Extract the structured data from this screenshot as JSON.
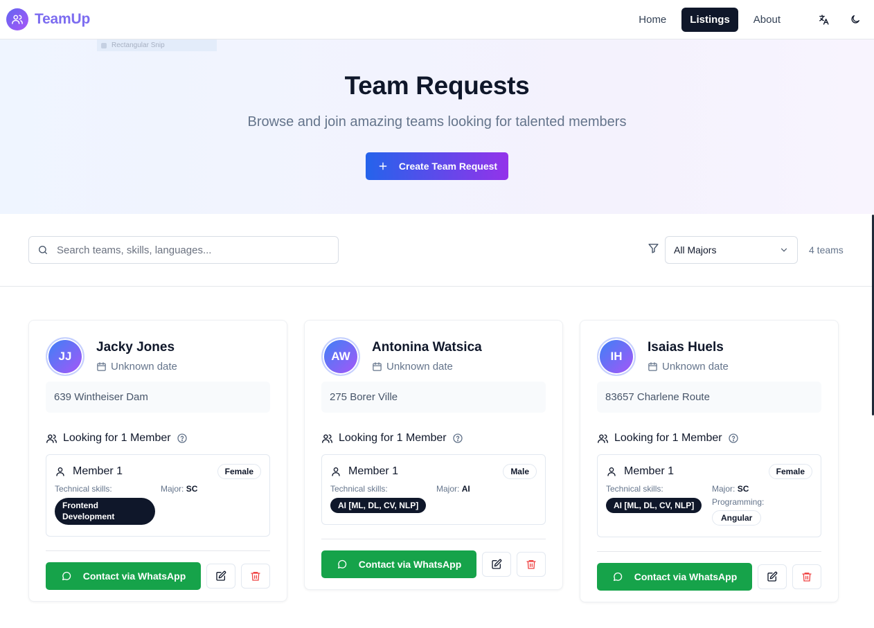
{
  "app": {
    "name": "TeamUp"
  },
  "nav": {
    "links": [
      {
        "label": "Home",
        "active": false
      },
      {
        "label": "Listings",
        "active": true
      },
      {
        "label": "About",
        "active": false
      }
    ],
    "icons": [
      "translate-icon",
      "moon-icon"
    ]
  },
  "overlay": {
    "snip_label": "Rectangular Snip"
  },
  "hero": {
    "title": "Team Requests",
    "subtitle": "Browse and join amazing teams looking for talented members",
    "cta_label": "Create Team Request"
  },
  "filters": {
    "search_placeholder": "Search teams, skills, languages...",
    "major_selected": "All Majors",
    "team_count": "4 teams"
  },
  "labels": {
    "technical_skills": "Technical skills:",
    "major": "Major:",
    "programming": "Programming:",
    "contact": "Contact via WhatsApp"
  },
  "cards": [
    {
      "initials": "JJ",
      "name": "Jacky Jones",
      "date": "Unknown date",
      "address": "639 Wintheiser Dam",
      "looking_for": "Looking for 1 Member",
      "member": {
        "title": "Member 1",
        "gender": "Female",
        "skill": "Frontend Development",
        "major": "SC"
      }
    },
    {
      "initials": "AW",
      "name": "Antonina Watsica",
      "date": "Unknown date",
      "address": "275 Borer Ville",
      "looking_for": "Looking for 1 Member",
      "member": {
        "title": "Member 1",
        "gender": "Male",
        "skill": "AI [ML, DL, CV, NLP]",
        "major": "AI"
      }
    },
    {
      "initials": "IH",
      "name": "Isaias Huels",
      "date": "Unknown date",
      "address": "83657 Charlene Route",
      "looking_for": "Looking for 1 Member",
      "member": {
        "title": "Member 1",
        "gender": "Female",
        "skill": "AI [ML, DL, CV, NLP]",
        "major": "SC",
        "programming": "Angular"
      }
    }
  ],
  "colors": {
    "brand_start": "#6366f1",
    "brand_end": "#a855f7",
    "cta_start": "#2563eb",
    "cta_end": "#9333ea",
    "whatsapp": "#16a34a",
    "danger": "#ef4444"
  }
}
